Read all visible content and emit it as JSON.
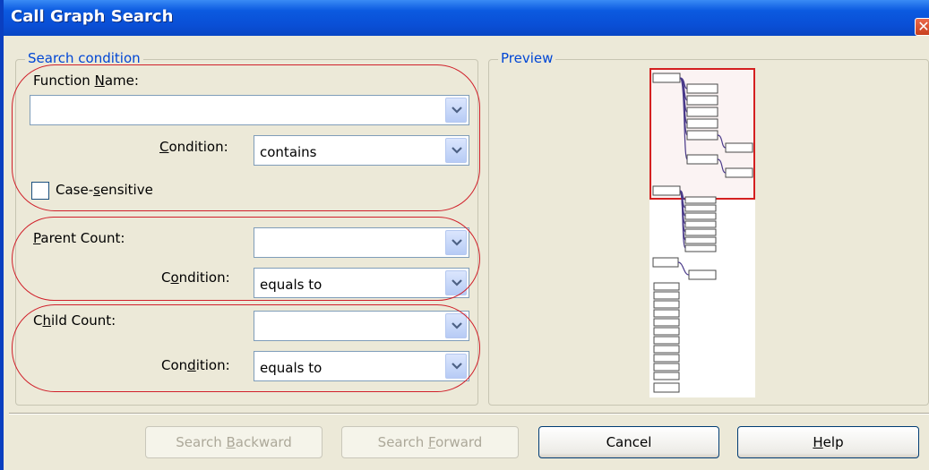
{
  "window": {
    "title": "Call Graph Search",
    "close_glyph": "✕"
  },
  "search_condition": {
    "group_title": "Search condition",
    "function_name": {
      "label_pre": "Function ",
      "label_accel": "N",
      "label_post": "ame:",
      "value": "",
      "condition_label_accel": "C",
      "condition_label_post": "ondition:",
      "condition_value": "contains"
    },
    "case_sensitive": {
      "label_pre": "Case-",
      "label_accel": "s",
      "label_post": "ensitive",
      "checked": false
    },
    "parent_count": {
      "label_pre": "",
      "label_accel": "P",
      "label_post": "arent Count:",
      "value": "",
      "condition_label_pre": "C",
      "condition_label_accel": "o",
      "condition_label_post": "ndition:",
      "condition_value": "equals to"
    },
    "child_count": {
      "label_pre": "C",
      "label_accel": "h",
      "label_post": "ild Count:",
      "value": "",
      "condition_label_pre": "Con",
      "condition_label_accel": "d",
      "condition_label_post": "ition:",
      "condition_value": "equals to"
    }
  },
  "preview": {
    "group_title": "Preview"
  },
  "buttons": {
    "search_backward": {
      "pre": "Search ",
      "accel": "B",
      "post": "ackward",
      "enabled": false
    },
    "search_forward": {
      "pre": "Search ",
      "accel": "F",
      "post": "orward",
      "enabled": false
    },
    "cancel": {
      "label": "Cancel",
      "enabled": true
    },
    "help": {
      "pre": "",
      "accel": "H",
      "post": "elp",
      "enabled": true
    }
  },
  "colors": {
    "title_bar": "#0a4fd6",
    "group_title": "#0046d5",
    "annotation_oval": "#d0202a",
    "graph_edge": "#4a3a8a"
  },
  "icons": {
    "dropdown": "chevron-down-icon",
    "close": "close-icon"
  }
}
